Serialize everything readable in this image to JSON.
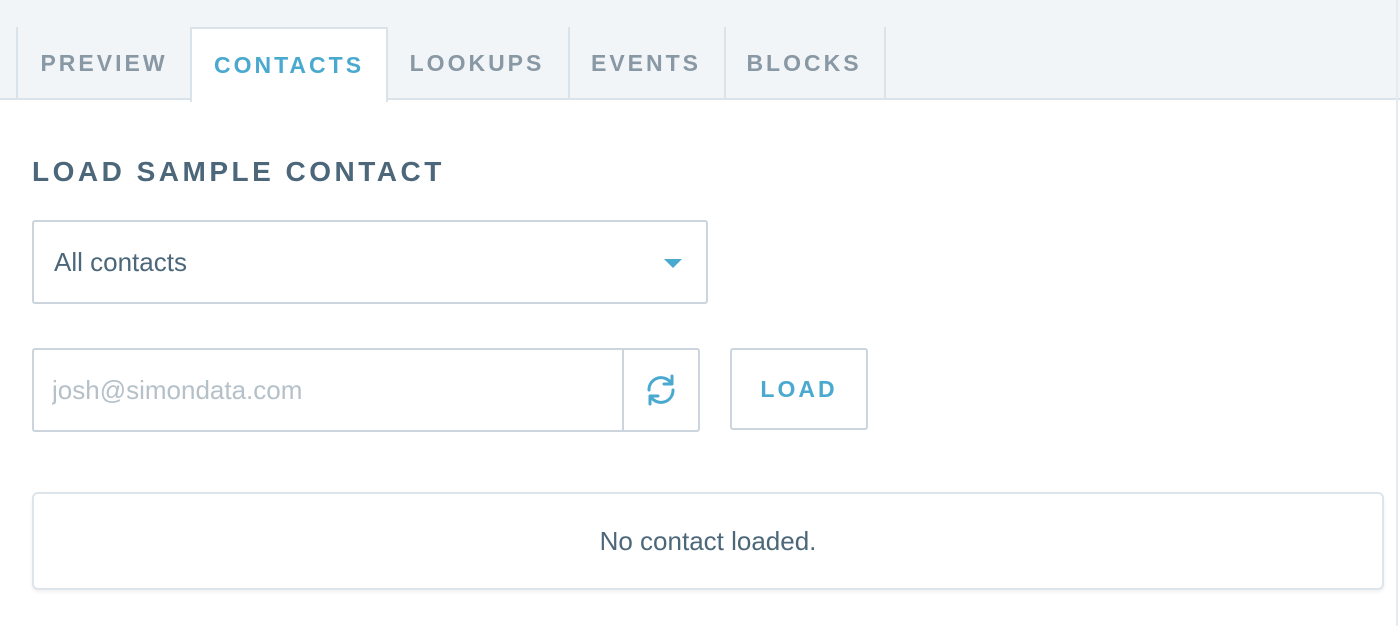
{
  "tabs": [
    {
      "label": "PREVIEW",
      "active": false
    },
    {
      "label": "CONTACTS",
      "active": true
    },
    {
      "label": "LOOKUPS",
      "active": false
    },
    {
      "label": "EVENTS",
      "active": false
    },
    {
      "label": "BLOCKS",
      "active": false
    }
  ],
  "section": {
    "title": "LOAD SAMPLE CONTACT"
  },
  "segment_select": {
    "value": "All contacts",
    "icon": "caret-down-icon"
  },
  "email_input": {
    "value": "",
    "placeholder": "josh@simondata.com"
  },
  "refresh_button": {
    "icon": "refresh-icon"
  },
  "load_button": {
    "label": "LOAD"
  },
  "status": {
    "message": "No contact loaded."
  },
  "colors": {
    "accent": "#4aa9cf",
    "text": "#4c6779",
    "muted_text": "#8898a4",
    "border": "#ccd5dd",
    "tabbar_bg": "#f1f5f8"
  }
}
